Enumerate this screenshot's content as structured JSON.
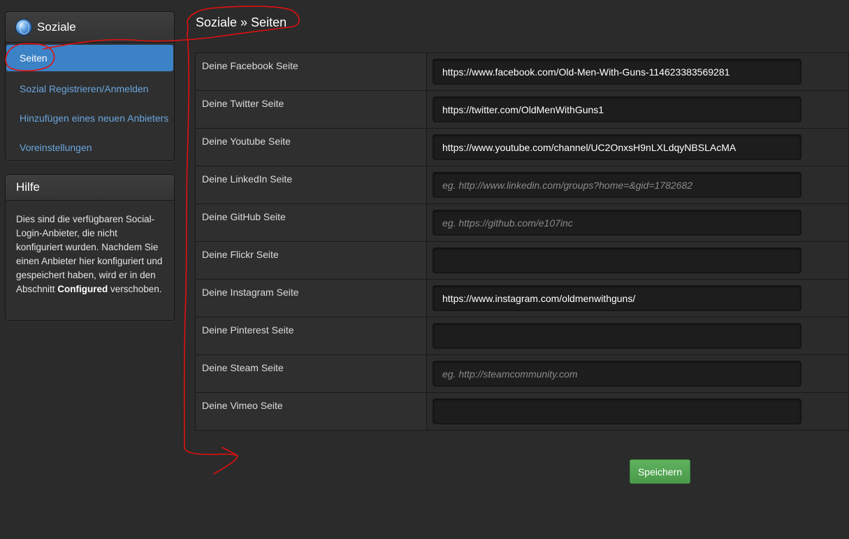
{
  "sidebar": {
    "title": "Soziale",
    "items": [
      {
        "label": "Seiten"
      },
      {
        "label": "Sozial Registrieren/Anmelden"
      },
      {
        "label": "Hinzufügen eines neuen Anbieters"
      },
      {
        "label": "Voreinstellungen"
      }
    ]
  },
  "help": {
    "title": "Hilfe",
    "text_before": "Dies sind die verfügbaren Social-Login-Anbieter, die nicht konfiguriert wurden. Nachdem Sie einen Anbieter hier konfiguriert und gespeichert haben, wird er in den Abschnitt ",
    "bold": "Configured",
    "text_after": " verschoben."
  },
  "page": {
    "title": "Soziale » Seiten"
  },
  "rows": [
    {
      "label": "Deine Facebook Seite",
      "value": "https://www.facebook.com/Old-Men-With-Guns-114623383569281",
      "placeholder": ""
    },
    {
      "label": "Deine Twitter Seite",
      "value": "https://twitter.com/OldMenWithGuns1",
      "placeholder": ""
    },
    {
      "label": "Deine Youtube Seite",
      "value": "https://www.youtube.com/channel/UC2OnxsH9nLXLdqyNBSLAcMA",
      "placeholder": ""
    },
    {
      "label": "Deine LinkedIn Seite",
      "value": "",
      "placeholder": "eg. http://www.linkedin.com/groups?home=&gid=1782682"
    },
    {
      "label": "Deine GitHub Seite",
      "value": "",
      "placeholder": "eg. https://github.com/e107inc"
    },
    {
      "label": "Deine Flickr Seite",
      "value": "",
      "placeholder": ""
    },
    {
      "label": "Deine Instagram Seite",
      "value": "https://www.instagram.com/oldmenwithguns/",
      "placeholder": ""
    },
    {
      "label": "Deine Pinterest Seite",
      "value": "",
      "placeholder": ""
    },
    {
      "label": "Deine Steam Seite",
      "value": "",
      "placeholder": "eg. http://steamcommunity.com"
    },
    {
      "label": "Deine Vimeo Seite",
      "value": "",
      "placeholder": ""
    }
  ],
  "buttons": {
    "save": "Speichern"
  },
  "colors": {
    "background": "#2b2b2b",
    "accent": "#3b82c6",
    "link": "#6aa6de",
    "save": "#5aab5a",
    "annotation": "#e01010"
  }
}
